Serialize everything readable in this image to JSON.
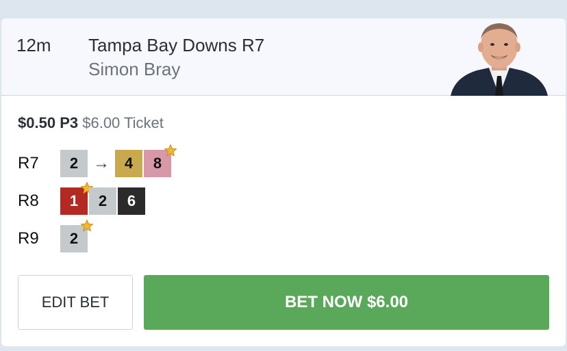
{
  "header": {
    "time_to_jump": "12m",
    "race_title": "Tampa Bay Downs R7",
    "tipster_name": "Simon Bray"
  },
  "bet": {
    "stake": "$0.50",
    "bet_type": "P3",
    "ticket_amount": "$6.00",
    "ticket_label": "Ticket"
  },
  "legs": [
    {
      "label": "R7",
      "runners": [
        {
          "number": "2",
          "color": "#c4c9cc",
          "text_color": "#111111",
          "star": false
        },
        {
          "number": "4",
          "color": "#c9a94e",
          "text_color": "#111111",
          "star": false
        },
        {
          "number": "8",
          "color": "#d799a8",
          "text_color": "#111111",
          "star": true
        }
      ]
    },
    {
      "label": "R8",
      "runners": [
        {
          "number": "1",
          "color": "#b22a22",
          "text_color": "#ffffff",
          "star": true
        },
        {
          "number": "2",
          "color": "#c4c9cc",
          "text_color": "#111111",
          "star": false
        },
        {
          "number": "6",
          "color": "#2b2b2b",
          "text_color": "#ffffff",
          "star": false
        }
      ]
    },
    {
      "label": "R9",
      "runners": [
        {
          "number": "2",
          "color": "#c4c9cc",
          "text_color": "#111111",
          "star": true
        }
      ]
    }
  ],
  "icons": {
    "arrow": "arrow-right-icon",
    "star": "star-icon",
    "avatar": "tipster-avatar"
  },
  "actions": {
    "edit_label": "EDIT BET",
    "bet_now_label": "BET NOW $6.00"
  },
  "colors": {
    "bet_now": "#5aa85a",
    "header_bg": "#f6f8fd",
    "star": "#f2b632"
  }
}
